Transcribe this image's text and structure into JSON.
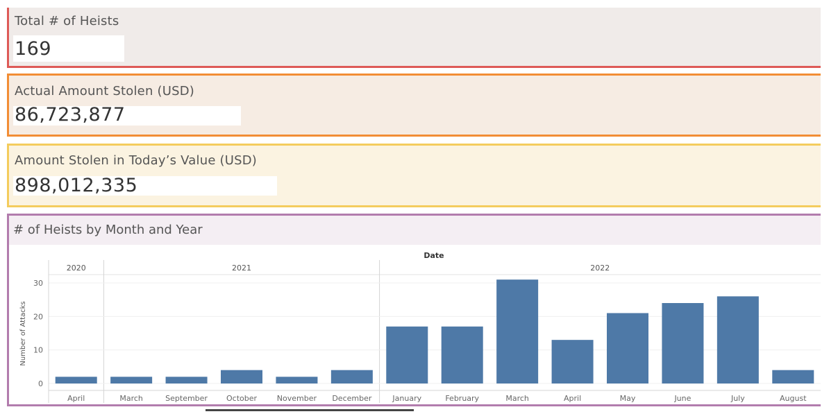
{
  "kpis": [
    {
      "title": "Total # of Heists",
      "value": "169"
    },
    {
      "title": "Actual Amount Stolen (USD)",
      "value": "86,723,877"
    },
    {
      "title": "Amount Stolen in Today’s Value (USD)",
      "value": "898,012,335"
    }
  ],
  "chart_data": {
    "type": "bar",
    "title": "# of Heists by Month and Year",
    "xlabel": "Date",
    "ylabel": "Number of Attacks",
    "ylim": [
      0,
      31
    ],
    "yticks": [
      0,
      10,
      20,
      30
    ],
    "grid": true,
    "legend": "none",
    "years": [
      {
        "label": "2020",
        "count": 1
      },
      {
        "label": "2021",
        "count": 5
      },
      {
        "label": "2022",
        "count": 8
      }
    ],
    "categories": [
      "April",
      "March",
      "September",
      "October",
      "November",
      "December",
      "January",
      "February",
      "March",
      "April",
      "May",
      "June",
      "July",
      "August"
    ],
    "values": [
      2,
      2,
      2,
      4,
      2,
      4,
      17,
      17,
      31,
      13,
      21,
      24,
      26,
      4
    ],
    "bar_color": "#4e79a7"
  },
  "colors": {
    "kpi1": "#de5a57",
    "kpi2": "#f28d35",
    "kpi3": "#f4cc5d",
    "chart": "#b27cad"
  }
}
